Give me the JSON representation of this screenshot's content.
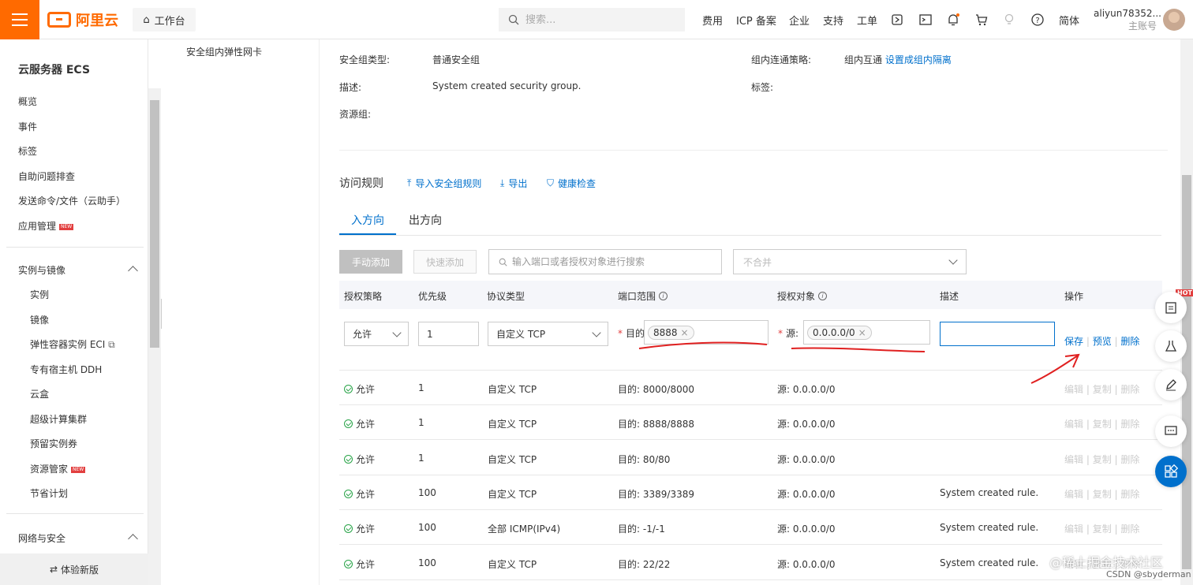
{
  "header": {
    "logo_text": "阿里云",
    "workbench": "工作台",
    "search_placeholder": "搜索...",
    "nav": [
      "费用",
      "ICP 备案",
      "企业",
      "支持",
      "工单"
    ],
    "lang": "简体",
    "user_name": "aliyun78352...",
    "user_role": "主账号"
  },
  "sidebar": {
    "title": "云服务器 ECS",
    "items": [
      "概览",
      "事件",
      "标签",
      "自助问题排查",
      "发送命令/文件（云助手）",
      "应用管理"
    ],
    "new_badge": "NEW",
    "group1": "实例与镜像",
    "group1_items": [
      "实例",
      "镜像",
      "弹性容器实例 ECI",
      "专有宿主机 DDH",
      "云盒",
      "超级计算集群",
      "预留实例券",
      "资源管家",
      "节省计划"
    ],
    "group2": "网络与安全",
    "bottom": "体验新版"
  },
  "subnav": {
    "item": "安全组内弹性网卡"
  },
  "info": {
    "type_label": "安全组类型:",
    "type_value": "普通安全组",
    "policy_label": "组内连通策略:",
    "policy_value": "组内互通",
    "policy_link": "设置成组内隔离",
    "desc_label": "描述:",
    "desc_value": "System created security group.",
    "tags_label": "标签:",
    "rg_label": "资源组:"
  },
  "rules": {
    "heading": "访问规则",
    "import": "导入安全组规则",
    "export": "导出",
    "health": "健康检查",
    "tab_in": "入方向",
    "tab_out": "出方向",
    "btn_manual": "手动添加",
    "btn_quick": "快速添加",
    "filter_placeholder": "输入端口或者授权对象进行搜索",
    "merge": "不合并",
    "columns": [
      "授权策略",
      "优先级",
      "协议类型",
      "端口范围",
      "授权对象",
      "描述",
      "操作"
    ],
    "edit": {
      "policy": "允许",
      "priority": "1",
      "protocol": "自定义 TCP",
      "port_label": "目的",
      "port_tag": "8888",
      "src_label": "源:",
      "src_tag": "0.0.0.0/0",
      "save": "保存",
      "preview": "预览",
      "delete": "删除"
    },
    "rows": [
      {
        "policy": "允许",
        "priority": "1",
        "protocol": "自定义 TCP",
        "port": "目的: 8000/8000",
        "src": "源: 0.0.0.0/0",
        "desc": ""
      },
      {
        "policy": "允许",
        "priority": "1",
        "protocol": "自定义 TCP",
        "port": "目的: 8888/8888",
        "src": "源: 0.0.0.0/0",
        "desc": ""
      },
      {
        "policy": "允许",
        "priority": "1",
        "protocol": "自定义 TCP",
        "port": "目的: 80/80",
        "src": "源: 0.0.0.0/0",
        "desc": ""
      },
      {
        "policy": "允许",
        "priority": "100",
        "protocol": "自定义 TCP",
        "port": "目的: 3389/3389",
        "src": "源: 0.0.0.0/0",
        "desc": "System created rule."
      },
      {
        "policy": "允许",
        "priority": "100",
        "protocol": "全部 ICMP(IPv4)",
        "port": "目的: -1/-1",
        "src": "源: 0.0.0.0/0",
        "desc": "System created rule."
      },
      {
        "policy": "允许",
        "priority": "100",
        "protocol": "自定义 TCP",
        "port": "目的: 22/22",
        "src": "源: 0.0.0.0/0",
        "desc": "System created rule."
      }
    ],
    "row_ops": [
      "编辑",
      "复制",
      "删除"
    ]
  },
  "rail": {
    "hot": "HOT"
  },
  "watermark": {
    "main": "@稀土掘金技术社区",
    "sub": "CSDN @sbyderman"
  },
  "colors": {
    "brand": "#ff6a00",
    "link": "#0070cc",
    "annotation": "#e02020"
  }
}
